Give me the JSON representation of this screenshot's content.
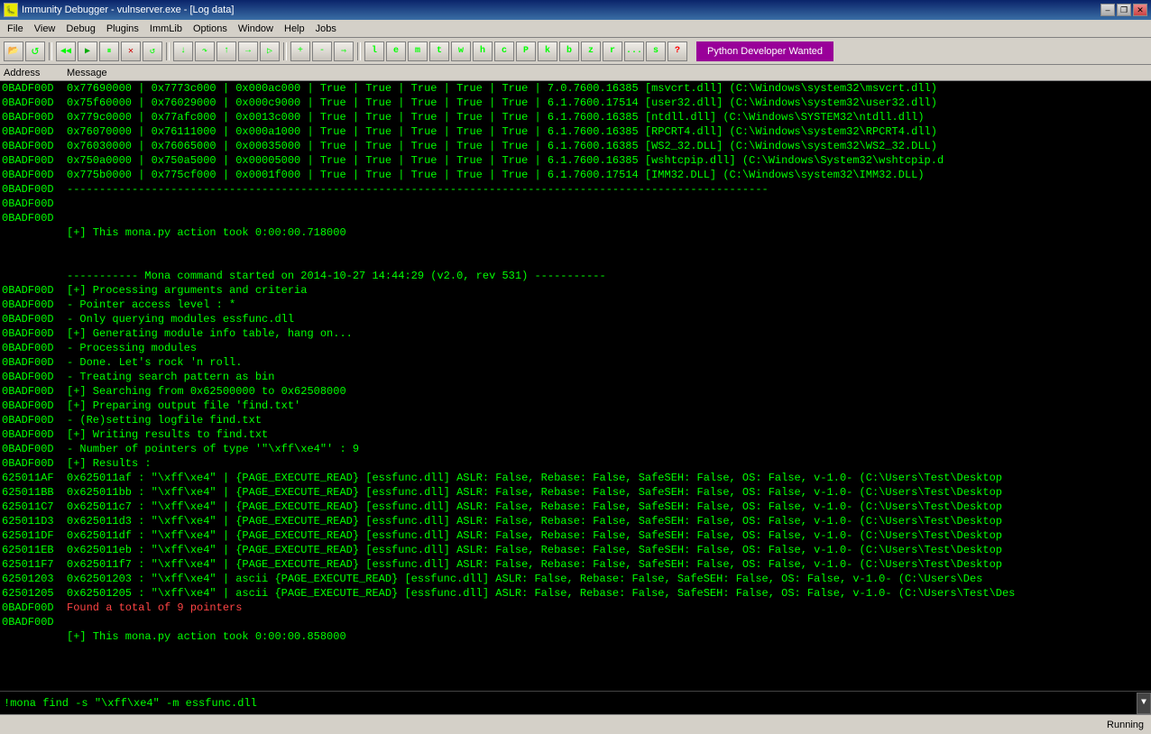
{
  "titlebar": {
    "icon": "🐛",
    "title": "Immunity Debugger - vulnserver.exe - [Log data]",
    "min": "–",
    "restore": "❐",
    "close": "✕",
    "inner_min": "–",
    "inner_restore": "❐",
    "inner_close": "✕"
  },
  "menubar": {
    "items": [
      "File",
      "View",
      "Debug",
      "Plugins",
      "ImmLib",
      "Options",
      "Window",
      "Help",
      "Jobs"
    ]
  },
  "toolbar": {
    "python_banner": "Python Developer Wanted",
    "buttons": [
      "📂",
      "💾",
      "⊕",
      "◀",
      "▶",
      "⏸",
      "⏹",
      "⏭",
      "⏮",
      "⏩",
      "⏪",
      "⏫",
      "⏬",
      "⏯",
      "⏺",
      "⏻",
      "⏼",
      "⏽",
      "⏾",
      "⏿",
      "↩",
      "↪",
      "l",
      "e",
      "m",
      "t",
      "w",
      "h",
      "c",
      "P",
      "k",
      "b",
      "z",
      "r",
      "...",
      "s",
      "?"
    ]
  },
  "columns": {
    "address": "Address",
    "message": "Message"
  },
  "log_rows": [
    {
      "addr": "0BADF00D",
      "msg": "0x77690000 | 0x7773c000 | 0x000ac000 | True   | True   | True   | True   | True   | 7.0.7600.16385 [msvcrt.dll] (C:\\Windows\\system32\\msvcrt.dll)",
      "style": ""
    },
    {
      "addr": "0BADF00D",
      "msg": "0x75f60000 | 0x76029000 | 0x000c9000 | True   | True   | True   | True   | True   | 6.1.7600.17514 [user32.dll] (C:\\Windows\\system32\\user32.dll)",
      "style": ""
    },
    {
      "addr": "0BADF00D",
      "msg": "0x779c0000 | 0x77afc000 | 0x0013c000 | True   | True   | True   | True   | True   | 6.1.7600.16385 [ntdll.dll] (C:\\Windows\\SYSTEM32\\ntdll.dll)",
      "style": ""
    },
    {
      "addr": "0BADF00D",
      "msg": "0x76070000 | 0x76111000 | 0x000a1000 | True   | True   | True   | True   | True   | 6.1.7600.16385 [RPCRT4.dll] (C:\\Windows\\system32\\RPCRT4.dll)",
      "style": ""
    },
    {
      "addr": "0BADF00D",
      "msg": "0x76030000 | 0x76065000 | 0x00035000 | True   | True   | True   | True   | True   | 6.1.7600.16385 [WS2_32.DLL] (C:\\Windows\\system32\\WS2_32.DLL)",
      "style": ""
    },
    {
      "addr": "0BADF00D",
      "msg": "0x750a0000 | 0x750a5000 | 0x00005000 | True   | True   | True   | True   | True   | 6.1.7600.16385 [wshtcpip.dll] (C:\\Windows\\System32\\wshtcpip.d",
      "style": ""
    },
    {
      "addr": "0BADF00D",
      "msg": "0x775b0000 | 0x775cf000 | 0x0001f000 | True   | True   | True   | True   | True   | 6.1.7600.17514 [IMM32.DLL] (C:\\Windows\\system32\\IMM32.DLL)",
      "style": ""
    },
    {
      "addr": "0BADF00D",
      "msg": "------------------------------------------------------------------------------------------------------------",
      "style": ""
    },
    {
      "addr": "0BADF00D",
      "msg": "",
      "style": ""
    },
    {
      "addr": "0BADF00D",
      "msg": "",
      "style": ""
    },
    {
      "addr": "",
      "msg": "    [+] This mona.py action took 0:00:00.718000",
      "style": ""
    },
    {
      "addr": "",
      "msg": "",
      "style": ""
    },
    {
      "addr": "",
      "msg": "",
      "style": ""
    },
    {
      "addr": "",
      "msg": "----------- Mona command started on 2014-10-27 14:44:29 (v2.0, rev 531) -----------",
      "style": ""
    },
    {
      "addr": "0BADF00D",
      "msg": "[+] Processing arguments and criteria",
      "style": ""
    },
    {
      "addr": "0BADF00D",
      "msg": "     - Pointer access level : *",
      "style": ""
    },
    {
      "addr": "0BADF00D",
      "msg": "     - Only querying modules essfunc.dll",
      "style": ""
    },
    {
      "addr": "0BADF00D",
      "msg": "[+] Generating module info table, hang on...",
      "style": ""
    },
    {
      "addr": "0BADF00D",
      "msg": "     - Processing modules",
      "style": ""
    },
    {
      "addr": "0BADF00D",
      "msg": "     - Done. Let's rock 'n roll.",
      "style": ""
    },
    {
      "addr": "0BADF00D",
      "msg": "     - Treating search pattern as bin",
      "style": ""
    },
    {
      "addr": "0BADF00D",
      "msg": "[+] Searching from 0x62500000 to 0x62508000",
      "style": ""
    },
    {
      "addr": "0BADF00D",
      "msg": "[+] Preparing output file 'find.txt'",
      "style": ""
    },
    {
      "addr": "0BADF00D",
      "msg": "     - (Re)setting logfile find.txt",
      "style": ""
    },
    {
      "addr": "0BADF00D",
      "msg": "[+] Writing results to find.txt",
      "style": ""
    },
    {
      "addr": "0BADF00D",
      "msg": "     - Number of pointers of type '\"\\xff\\xe4\"' : 9",
      "style": ""
    },
    {
      "addr": "0BADF00D",
      "msg": "[+] Results :",
      "style": ""
    },
    {
      "addr": "625011AF",
      "msg": "  0x625011af : \"\\xff\\xe4\" |  {PAGE_EXECUTE_READ} [essfunc.dll] ASLR: False, Rebase: False, SafeSEH: False, OS: False, v-1.0- (C:\\Users\\Test\\Desktop",
      "style": ""
    },
    {
      "addr": "625011BB",
      "msg": "  0x625011bb : \"\\xff\\xe4\" |  {PAGE_EXECUTE_READ} [essfunc.dll] ASLR: False, Rebase: False, SafeSEH: False, OS: False, v-1.0- (C:\\Users\\Test\\Desktop",
      "style": ""
    },
    {
      "addr": "625011C7",
      "msg": "  0x625011c7 : \"\\xff\\xe4\" |  {PAGE_EXECUTE_READ} [essfunc.dll] ASLR: False, Rebase: False, SafeSEH: False, OS: False, v-1.0- (C:\\Users\\Test\\Desktop",
      "style": ""
    },
    {
      "addr": "625011D3",
      "msg": "  0x625011d3 : \"\\xff\\xe4\" |  {PAGE_EXECUTE_READ} [essfunc.dll] ASLR: False, Rebase: False, SafeSEH: False, OS: False, v-1.0- (C:\\Users\\Test\\Desktop",
      "style": ""
    },
    {
      "addr": "625011DF",
      "msg": "  0x625011df : \"\\xff\\xe4\" |  {PAGE_EXECUTE_READ} [essfunc.dll] ASLR: False, Rebase: False, SafeSEH: False, OS: False, v-1.0- (C:\\Users\\Test\\Desktop",
      "style": ""
    },
    {
      "addr": "625011EB",
      "msg": "  0x625011eb : \"\\xff\\xe4\" |  {PAGE_EXECUTE_READ} [essfunc.dll] ASLR: False, Rebase: False, SafeSEH: False, OS: False, v-1.0- (C:\\Users\\Test\\Desktop",
      "style": ""
    },
    {
      "addr": "625011F7",
      "msg": "  0x625011f7 : \"\\xff\\xe4\" |  {PAGE_EXECUTE_READ} [essfunc.dll] ASLR: False, Rebase: False, SafeSEH: False, OS: False, v-1.0- (C:\\Users\\Test\\Desktop",
      "style": ""
    },
    {
      "addr": "62501203",
      "msg": "  0x62501203 : \"\\xff\\xe4\" | ascii {PAGE_EXECUTE_READ} [essfunc.dll] ASLR: False, Rebase: False, SafeSEH: False, OS: False, v-1.0- (C:\\Users\\Des",
      "style": ""
    },
    {
      "addr": "62501205",
      "msg": "  0x62501205 : \"\\xff\\xe4\" | ascii {PAGE_EXECUTE_READ} [essfunc.dll] ASLR: False, Rebase: False, SafeSEH: False, OS: False, v-1.0- (C:\\Users\\Test\\Des",
      "style": ""
    },
    {
      "addr": "0BADF00D",
      "msg": "    Found a total of 9 pointers",
      "style": "red"
    },
    {
      "addr": "0BADF00D",
      "msg": "",
      "style": ""
    },
    {
      "addr": "",
      "msg": "    [+] This mona.py action took 0:00:00.858000",
      "style": ""
    }
  ],
  "command": {
    "value": "!mona find -s \"\\xff\\xe4\" -m essfunc.dll",
    "placeholder": ""
  },
  "statusbar": {
    "status": "Running"
  }
}
